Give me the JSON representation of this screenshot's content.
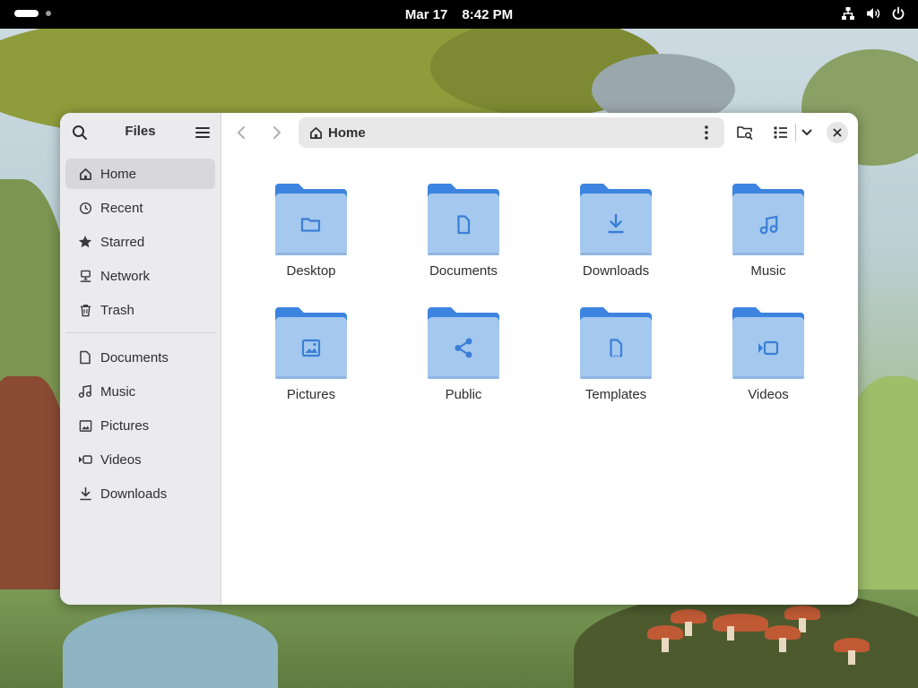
{
  "topbar": {
    "date": "Mar 17",
    "time": "8:42 PM",
    "tray_icons": [
      "network-icon",
      "volume-icon",
      "power-icon"
    ]
  },
  "window": {
    "sidebar": {
      "title": "Files",
      "places": [
        {
          "label": "Home",
          "icon": "home-icon",
          "active": true
        },
        {
          "label": "Recent",
          "icon": "clock-icon",
          "active": false
        },
        {
          "label": "Starred",
          "icon": "star-icon",
          "active": false
        },
        {
          "label": "Network",
          "icon": "network-icon",
          "active": false
        },
        {
          "label": "Trash",
          "icon": "trash-icon",
          "active": false
        }
      ],
      "bookmarks": [
        {
          "label": "Documents",
          "icon": "document-icon"
        },
        {
          "label": "Music",
          "icon": "music-icon"
        },
        {
          "label": "Pictures",
          "icon": "image-icon"
        },
        {
          "label": "Videos",
          "icon": "video-icon"
        },
        {
          "label": "Downloads",
          "icon": "download-icon"
        }
      ]
    },
    "header": {
      "location": "Home"
    },
    "folders": [
      {
        "label": "Desktop",
        "emblem": "folder-emblem"
      },
      {
        "label": "Documents",
        "emblem": "document-emblem"
      },
      {
        "label": "Downloads",
        "emblem": "download-emblem"
      },
      {
        "label": "Music",
        "emblem": "music-emblem"
      },
      {
        "label": "Pictures",
        "emblem": "image-emblem"
      },
      {
        "label": "Public",
        "emblem": "share-emblem"
      },
      {
        "label": "Templates",
        "emblem": "template-emblem"
      },
      {
        "label": "Videos",
        "emblem": "video-emblem"
      }
    ]
  },
  "colors": {
    "folder_back": "#3c84e0",
    "folder_front": "#a4c8ee",
    "emblem": "#3a7fd6",
    "topbar": "#000000",
    "sidebar": "#ebebed",
    "active_row": "#d8d8da"
  }
}
